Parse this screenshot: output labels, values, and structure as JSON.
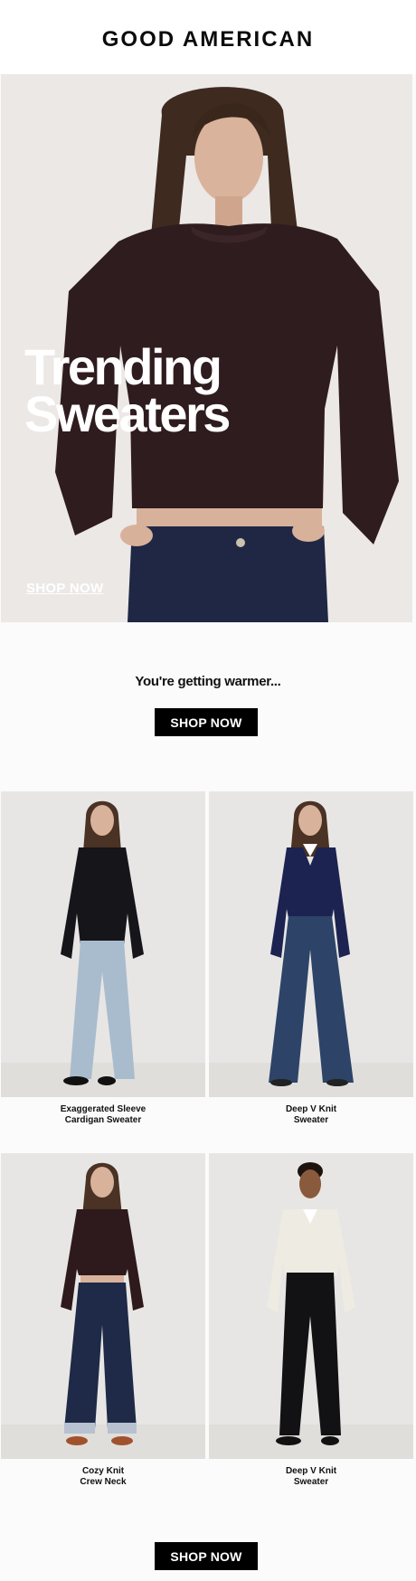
{
  "brand": {
    "name": "GOOD AMERICAN"
  },
  "hero": {
    "title_line1": "Trending",
    "title_line2": "Sweaters",
    "link_label": "SHOP NOW"
  },
  "promo": {
    "heading": "You're getting warmer...",
    "button_label": "SHOP NOW"
  },
  "products": [
    {
      "name_line1": "Exaggerated Sleeve",
      "name_line2": "Cardigan Sweater",
      "sweater_color": "#15151a",
      "jeans_color": "#a9bccd"
    },
    {
      "name_line1": "Deep V Knit",
      "name_line2": "Sweater",
      "sweater_color": "#1c2350",
      "jeans_color": "#2d4468"
    },
    {
      "name_line1": "Cozy Knit",
      "name_line2": "Crew Neck",
      "sweater_color": "#2e1a1c",
      "jeans_color": "#1e2a47"
    },
    {
      "name_line1": "Deep V Knit",
      "name_line2": "Sweater",
      "sweater_color": "#eeebe3",
      "jeans_color": "#121214"
    }
  ],
  "footer": {
    "button_label": "SHOP NOW"
  },
  "colors": {
    "background": "#ffffff",
    "button": "#000000",
    "button_text": "#ffffff",
    "hero_sweater": "#2f1c1f"
  }
}
